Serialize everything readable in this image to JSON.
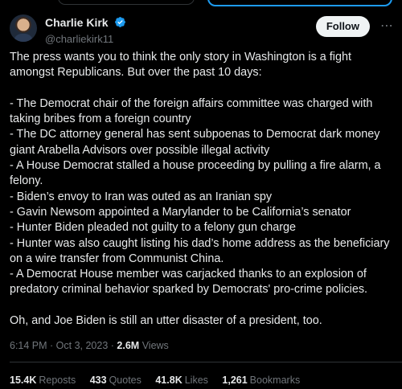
{
  "author": {
    "display_name": "Charlie Kirk",
    "handle": "@charliekirk11",
    "verified": true
  },
  "follow_label": "Follow",
  "tweet_lines": [
    "The press wants you to think the only story in Washington is a fight amongst Republicans. But over the past 10 days:",
    "",
    "- The Democrat chair of the foreign affairs committee was charged with taking bribes from a foreign country",
    "- The DC attorney general has sent subpoenas to Democrat dark money giant Arabella Advisors over possible illegal activity",
    "- A House Democrat stalled a house proceeding by pulling a fire alarm, a felony.",
    "- Biden’s envoy to Iran was outed as an Iranian spy",
    "- Gavin Newsom appointed a Marylander to be California’s senator",
    "- Hunter Biden pleaded not guilty to a felony gun charge",
    "- Hunter was also caught listing his dad’s home address as the beneficiary on a wire transfer from Communist China.",
    "- A Democrat House member was carjacked thanks to an explosion of predatory criminal behavior sparked by Democrats' pro-crime policies.",
    "",
    "Oh, and Joe Biden is still an utter disaster of a president, too."
  ],
  "meta": {
    "timestamp": "6:14 PM · Oct 3, 2023",
    "separator": " · ",
    "views_count": "2.6M",
    "views_label": "Views"
  },
  "stats": [
    {
      "count": "15.4K",
      "label": "Reposts"
    },
    {
      "count": "433",
      "label": "Quotes"
    },
    {
      "count": "41.8K",
      "label": "Likes"
    },
    {
      "count": "1,261",
      "label": "Bookmarks"
    }
  ],
  "colors": {
    "background": "#000000",
    "text": "#e7e9ea",
    "muted": "#71767b",
    "verified_blue": "#1d9bf0"
  }
}
